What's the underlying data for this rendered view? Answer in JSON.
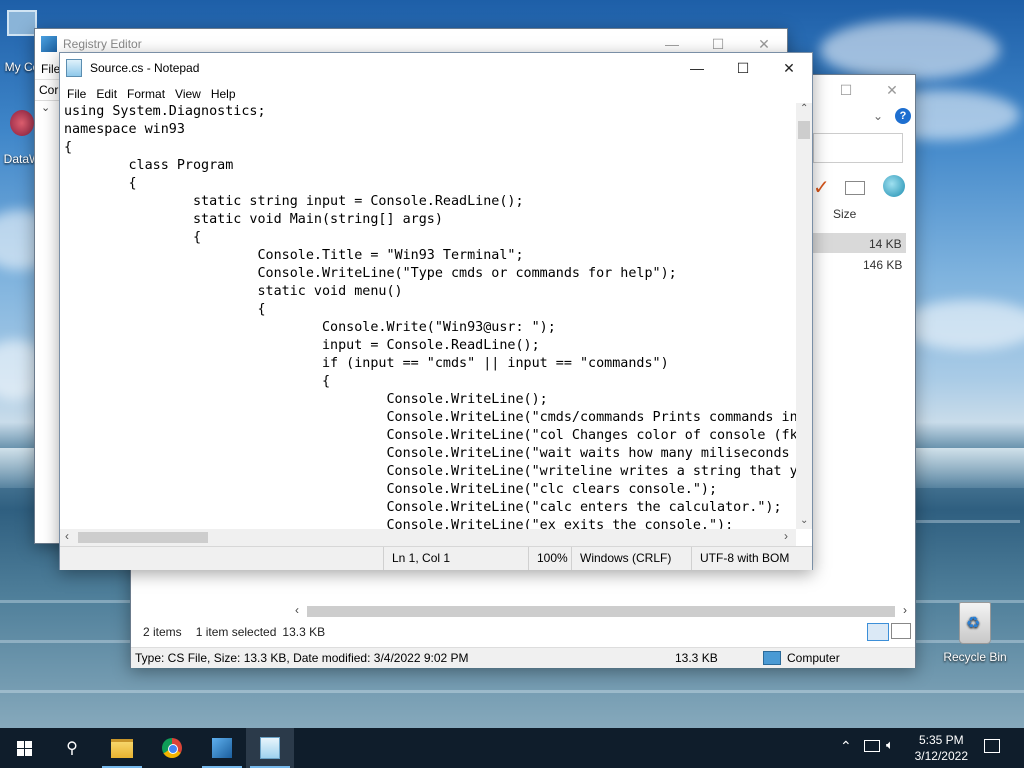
{
  "desktop": {
    "icons": [
      {
        "label": "My Co"
      },
      {
        "label": "DataW"
      },
      {
        "label": "Recycle Bin"
      }
    ]
  },
  "registry": {
    "title": "Registry Editor",
    "menu_first": "File",
    "address": "Cor"
  },
  "explorer": {
    "column_size": "Size",
    "sizes": [
      "14 KB",
      "146 KB"
    ],
    "items_count": "2 items",
    "selected": "1 item selected",
    "selected_size": "13.3 KB",
    "status_text": "Type: CS File, Size: 13.3 KB, Date modified: 3/4/2022 9:02 PM",
    "status_size": "13.3 KB",
    "status_location": "Computer"
  },
  "notepad": {
    "title": "Source.cs - Notepad",
    "menu": [
      "File",
      "Edit",
      "Format",
      "View",
      "Help"
    ],
    "lines": [
      "using System.Diagnostics;",
      "namespace win93",
      "{",
      "        class Program",
      "        {",
      "                static string input = Console.ReadLine();",
      "                static void Main(string[] args)",
      "                {",
      "                        Console.Title = \"Win93 Terminal\";",
      "                        Console.WriteLine(\"Type cmds or commands for help\");",
      "                        static void menu()",
      "                        {",
      "                                Console.Write(\"Win93@usr: \");",
      "                                input = Console.ReadLine();",
      "                                if (input == \"cmds\" || input == \"commands\")",
      "                                {",
      "                                        Console.WriteLine();",
      "                                        Console.WriteLine(\"cmds/commands Prints commands in",
      "                                        Console.WriteLine(\"col Changes color of console (fk",
      "                                        Console.WriteLine(\"wait waits how many miliseconds",
      "                                        Console.WriteLine(\"writeline writes a string that y",
      "                                        Console.WriteLine(\"clc clears console.\");",
      "                                        Console.WriteLine(\"calc enters the calculator.\");",
      "                                        Console.WriteLine(\"ex exits the console.\");"
    ],
    "status": {
      "position": "Ln 1, Col 1",
      "zoom": "100%",
      "line_ending": "Windows (CRLF)",
      "encoding": "UTF-8 with BOM"
    }
  },
  "taskbar": {
    "time": "5:35 PM",
    "date": "3/12/2022"
  }
}
